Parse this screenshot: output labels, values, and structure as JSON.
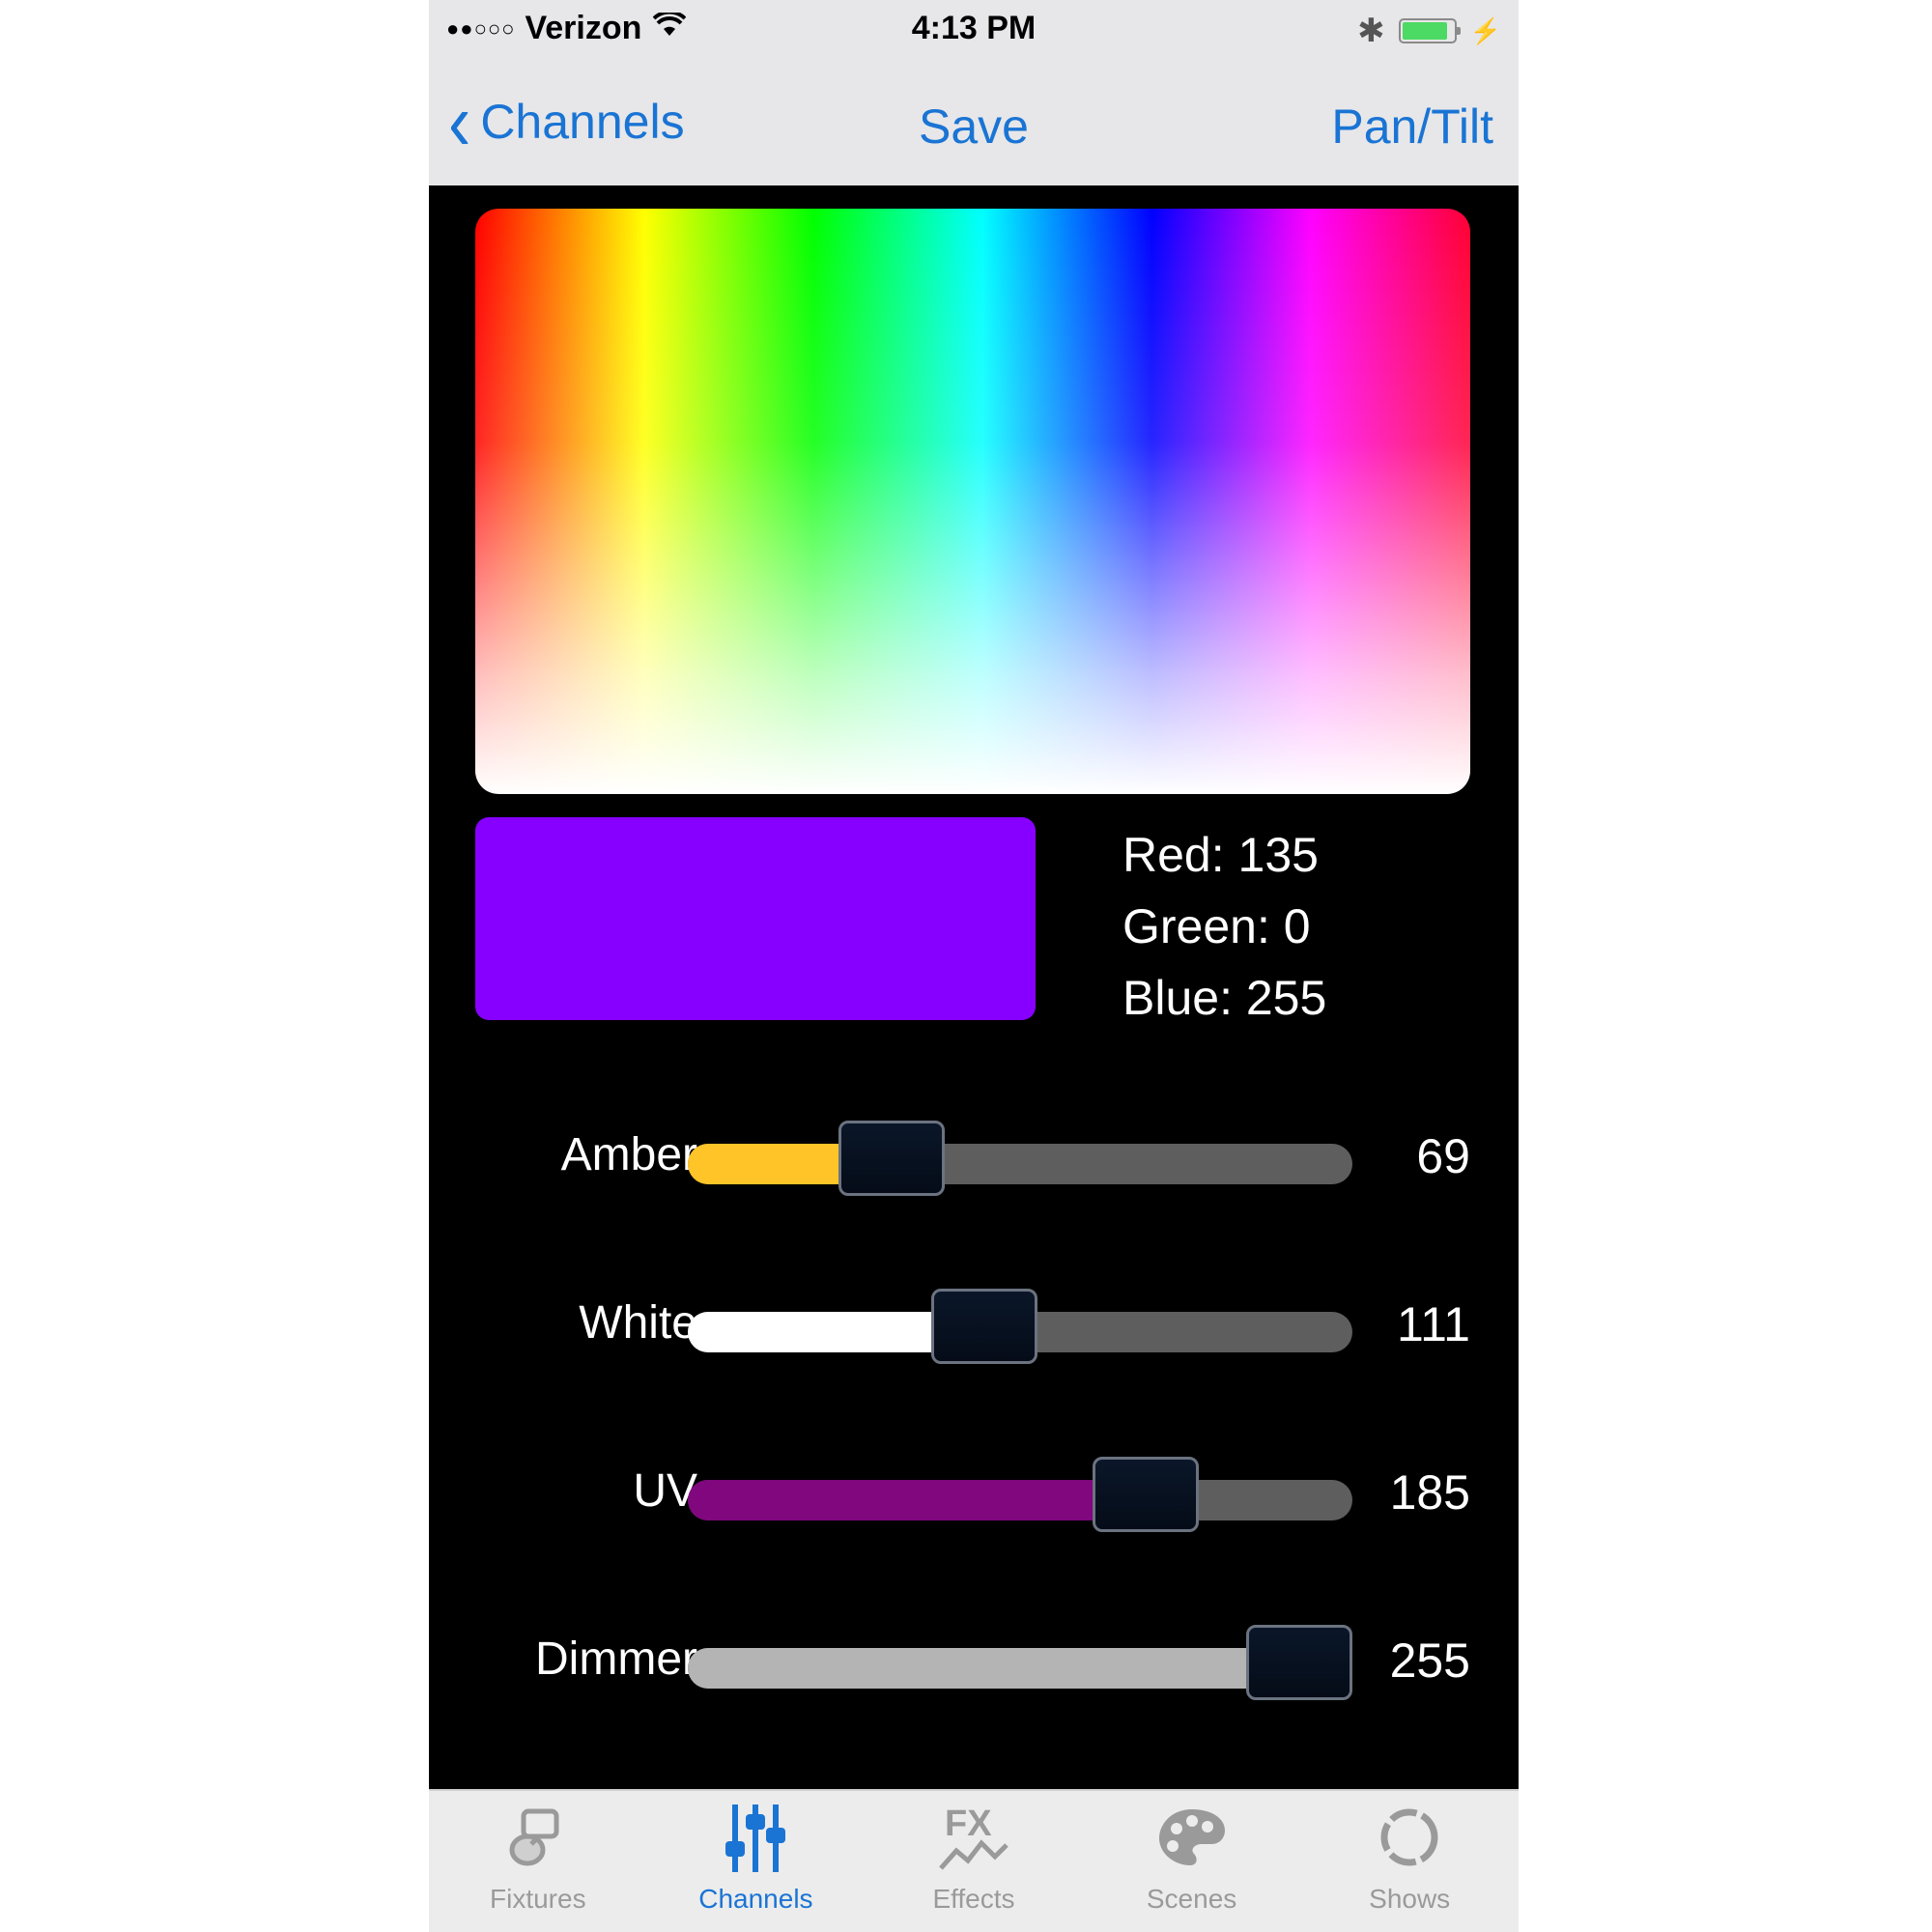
{
  "status_bar": {
    "signal_dots": "●●○○○",
    "carrier": "Verizon",
    "time": "4:13 PM",
    "bluetooth_glyph": "✱",
    "battery_level": 0.9,
    "charging_glyph": "⚡"
  },
  "nav": {
    "back_label": "Channels",
    "center_label": "Save",
    "right_label": "Pan/Tilt"
  },
  "color": {
    "preview_hex": "#8700ff",
    "red_text": "Red: 135",
    "green_text": "Green: 0",
    "blue_text": "Blue: 255"
  },
  "sliders": [
    {
      "label": "Amber",
      "value": 69,
      "max": 255,
      "display": "69",
      "fill": "#ffc428"
    },
    {
      "label": "White",
      "value": 111,
      "max": 255,
      "display": "111",
      "fill": "#ffffff"
    },
    {
      "label": "UV",
      "value": 185,
      "max": 255,
      "display": "185",
      "fill": "#80077e"
    },
    {
      "label": "Dimmer",
      "value": 255,
      "max": 255,
      "display": "255",
      "fill": "#b4b4b4"
    }
  ],
  "tabs": [
    {
      "label": "Fixtures",
      "icon": "fixture-icon",
      "active": false
    },
    {
      "label": "Channels",
      "icon": "channels-sliders-icon",
      "active": true
    },
    {
      "label": "Effects",
      "icon": "fx-icon",
      "active": false
    },
    {
      "label": "Scenes",
      "icon": "palette-icon",
      "active": false
    },
    {
      "label": "Shows",
      "icon": "shows-circle-icon",
      "active": false
    }
  ],
  "colors": {
    "accent": "#1a74d4",
    "bar_background": "#e7e7e9",
    "screen_background": "#000000"
  }
}
